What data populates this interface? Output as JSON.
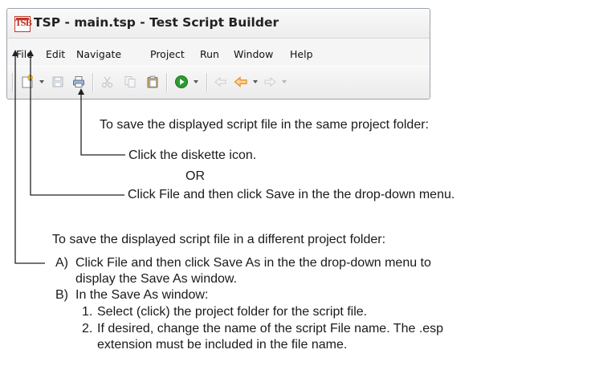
{
  "window": {
    "title": "TSP - main.tsp - Test Script Builder",
    "icon": "TSB"
  },
  "menu": {
    "file": "File",
    "edit": "Edit",
    "navigate": "Navigate",
    "project": "Project",
    "run": "Run",
    "window": "Window",
    "help": "Help"
  },
  "toolbar": {
    "icons": [
      "new-script-icon",
      "save-diskette-icon",
      "print-icon",
      "cut-icon",
      "copy-icon",
      "paste-icon",
      "run-icon",
      "back-icon",
      "previous-edit-icon",
      "forward-icon"
    ]
  },
  "colors": {
    "run_green": "#2e9b2e",
    "arrow_orange": "#e8911e",
    "callout_line": "#222222"
  },
  "instructions": {
    "same_folder_heading": "To save the displayed script file in the same project folder:",
    "click_diskette": "Click the diskette icon.",
    "or": "OR",
    "click_file_save": "Click File and then click Save in the the drop-down menu.",
    "different_folder_heading": "To save the displayed script file in a different project folder:",
    "step_a_marker": "A)",
    "step_a_line1": "Click File and then click Save As in the the drop-down menu to",
    "step_a_line2": "display the Save As window.",
    "step_b_marker": "B)",
    "step_b_text": "In the Save As window:",
    "step_b1_marker": "1.",
    "step_b1_text": "Select (click) the project folder for the script file.",
    "step_b2_marker": "2.",
    "step_b2_line1": "If desired, change the name of the script File name. The .esp",
    "step_b2_line2": "extension must be included in the file name."
  }
}
